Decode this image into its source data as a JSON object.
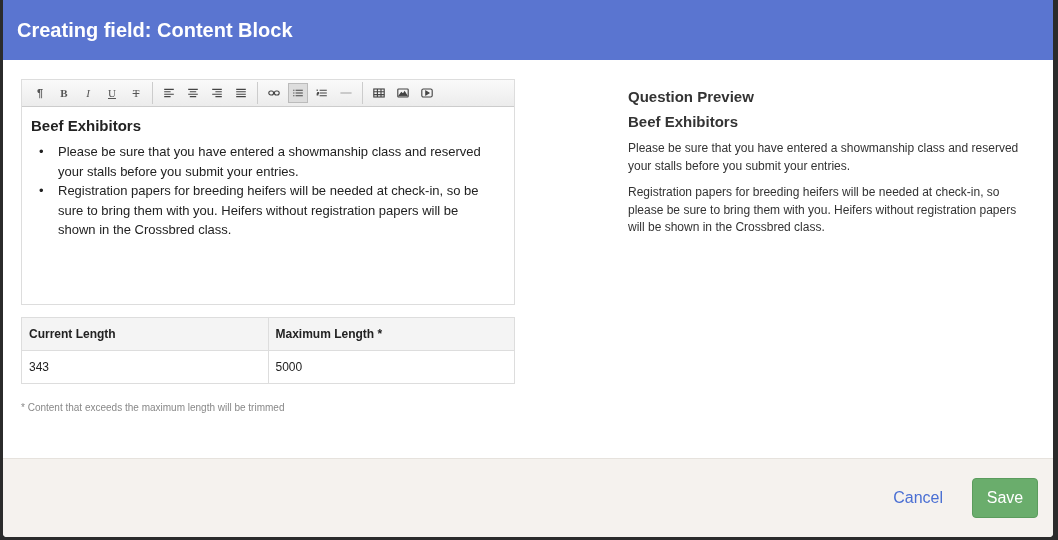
{
  "dialog": {
    "title": "Creating field: Content Block"
  },
  "toolbar": [
    [
      {
        "kind": "paragraph",
        "label": "¶",
        "on": false
      },
      {
        "kind": "bold",
        "label": "B",
        "on": false
      },
      {
        "kind": "italic",
        "label": "I",
        "on": false
      },
      {
        "kind": "underline",
        "label": "U",
        "on": false
      },
      {
        "kind": "strike",
        "label": "T",
        "on": false
      }
    ],
    [
      {
        "kind": "align-left",
        "on": false
      },
      {
        "kind": "align-center",
        "on": false
      },
      {
        "kind": "align-right",
        "on": false
      },
      {
        "kind": "justify",
        "on": false
      }
    ],
    [
      {
        "kind": "link",
        "on": false
      },
      {
        "kind": "bullet-list",
        "on": true
      },
      {
        "kind": "numbered-list",
        "on": false
      },
      {
        "kind": "rule",
        "on": false
      }
    ],
    [
      {
        "kind": "table",
        "on": false
      },
      {
        "kind": "image",
        "on": false
      },
      {
        "kind": "video",
        "on": false
      }
    ]
  ],
  "editor": {
    "heading": "Beef Exhibitors",
    "bullets": [
      {
        "marker": "•",
        "text": "Please be sure that you have entered a showmanship class and reserved your stalls before you submit your entries."
      },
      {
        "marker": "•",
        "text": "Registration papers for breeding heifers will be needed at check-in, so be sure to bring them with you. Heifers without registration papers will be shown in the Crossbred class."
      }
    ]
  },
  "length_table": {
    "columns": [
      "Current Length",
      "Maximum Length *"
    ],
    "row": [
      "343",
      "5000"
    ]
  },
  "note": "* Content that exceeds the maximum length will be trimmed",
  "preview": {
    "title": "Question Preview",
    "heading": "Beef Exhibitors",
    "paragraphs": [
      "Please be sure that you have entered a showmanship class and reserved your stalls before you submit your entries.",
      "Registration papers for breeding heifers will be needed at check-in, so please be sure to bring them with you. Heifers without registration papers will be shown in the Crossbred class."
    ]
  },
  "footer": {
    "cancel": "Cancel",
    "save": "Save"
  }
}
